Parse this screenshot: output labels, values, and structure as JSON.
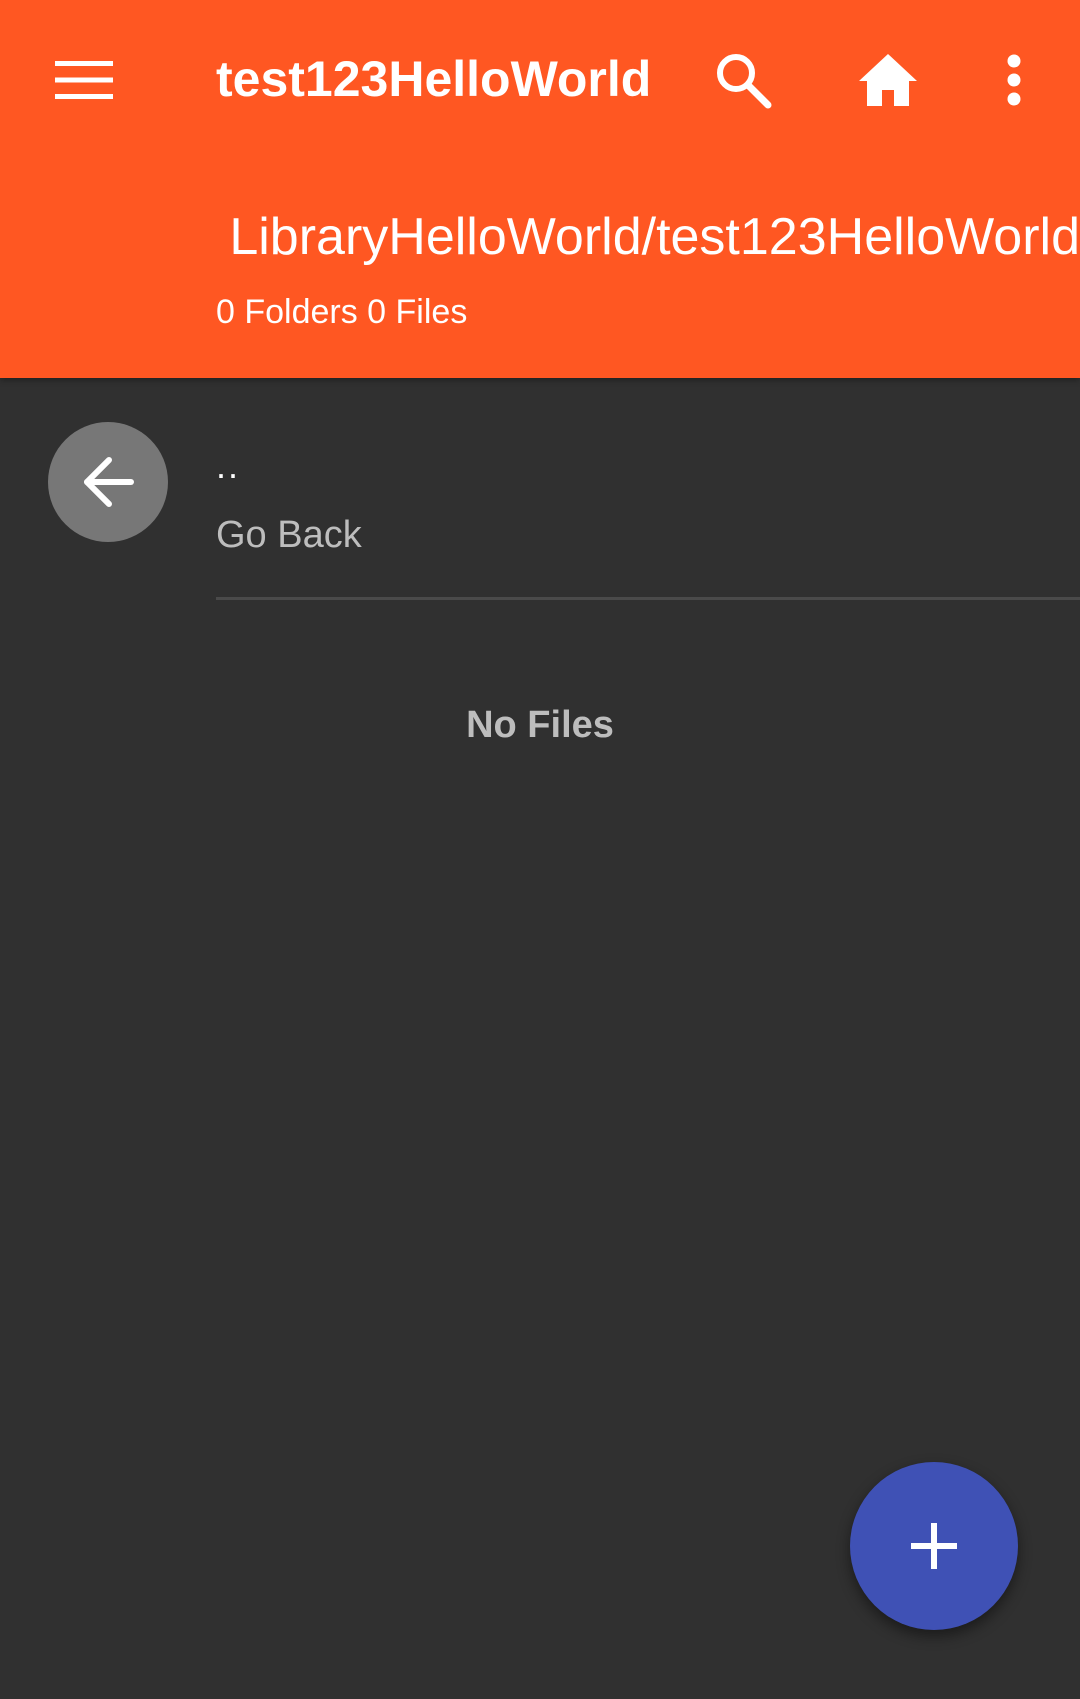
{
  "appbar": {
    "title": "test123HelloWorld",
    "path": "LibraryHelloWorld/test123HelloWorld",
    "counts": "0 Folders 0 Files",
    "background_color": "#ff5722",
    "icons": {
      "menu": "menu-icon",
      "search": "search-icon",
      "home": "home-icon",
      "more": "more-vert-icon"
    }
  },
  "list": {
    "back_item": {
      "name": "..",
      "label": "Go Back",
      "icon": "arrow-back-icon"
    },
    "empty_message": "No Files"
  },
  "fab": {
    "icon": "plus-icon",
    "color": "#3f51b5"
  },
  "background_color": "#303030"
}
